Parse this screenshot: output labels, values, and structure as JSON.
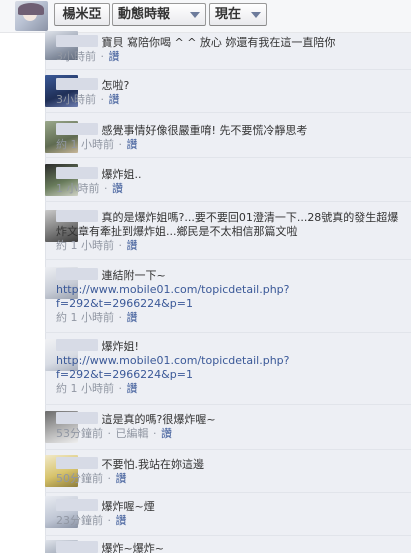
{
  "header": {
    "profile_name": "楊米亞",
    "feed_label": "動態時報",
    "time_label": "現在"
  },
  "comments": [
    {
      "message": "寶貝 寫陪你喝 ^ ^ 放心 妳還有我在這一直陪你",
      "time": "3小時前",
      "reply": "讚"
    },
    {
      "message": "怎啦?",
      "time": "3小時前",
      "reply": "讚"
    },
    {
      "message": "感覺事情好像很嚴重唷! 先不要慌冷靜思考",
      "time": "約 1 小時前",
      "reply": "讚"
    },
    {
      "message": "爆炸姐..",
      "time": "1 小時前",
      "reply": "讚"
    },
    {
      "message": "真的是爆炸姐嗎?...要不要回01澄清一下...28號真的發生超爆炸文章有牽扯到爆炸姐...鄉民是不太相信那篇文啦",
      "time": "約 1 小時前",
      "reply": "讚"
    },
    {
      "message": "連結附一下~",
      "link": "http://www.mobile01.com/topicdetail.php?f=292&t=2966224&p=1",
      "time": "約 1 小時前",
      "reply": "讚"
    },
    {
      "message": "爆炸姐!",
      "link": "http://www.mobile01.com/topicdetail.php?f=292&t=2966224&p=1",
      "time": "約 1 小時前",
      "reply": "讚"
    },
    {
      "message": "這是真的嗎?很爆炸喔~",
      "time": "53分鐘前",
      "edited": "已編輯",
      "reply": "讚"
    },
    {
      "message": "不要怕.我站在妳這邊",
      "time": "50分鐘前",
      "reply": "讚"
    },
    {
      "message": "爆炸喔~煙",
      "time": "23分鐘前",
      "reply": "讚"
    },
    {
      "message": "爆炸~爆炸~"
    }
  ]
}
